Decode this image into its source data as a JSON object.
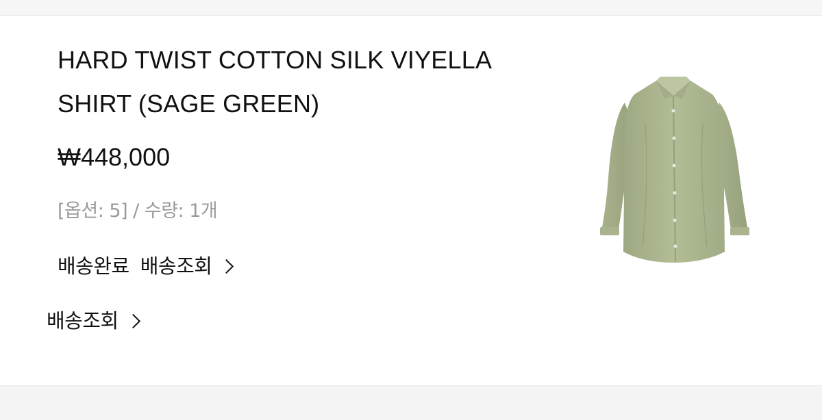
{
  "order_item": {
    "product_name_line1": "HARD TWIST COTTON SILK VIYELLA",
    "product_name_line2": "SHIRT (SAGE GREEN)",
    "price": "₩448,000",
    "options": "[옵션: 5] / 수량: 1개",
    "status": "배송완료",
    "tracking_link": "배송조회",
    "image": {
      "icon": "sage-green-shirt-photo",
      "color": "#aab78f"
    }
  },
  "footer_action": {
    "tracking_link": "배송조회"
  }
}
